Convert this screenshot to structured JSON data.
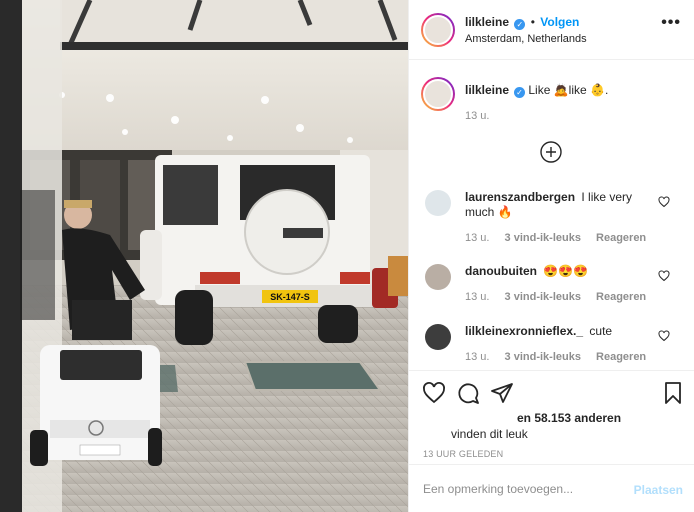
{
  "post": {
    "username": "lilkleine",
    "follow_label": "Volgen",
    "location": "Amsterdam, Netherlands",
    "more_label": "•••",
    "license_plate": "SK-147-S"
  },
  "caption": {
    "username": "lilkleine",
    "text": "Like 🙇like 👶.",
    "time": "13 u."
  },
  "load_more_icon": "plus-circle-icon",
  "comments": [
    {
      "username": "laurenszandbergen",
      "text": "I like very much 🔥",
      "time": "13 u.",
      "likes": "3 vind-ik-leuks",
      "reply": "Reageren"
    },
    {
      "username": "danoubuiten",
      "text": "😍😍😍",
      "time": "13 u.",
      "likes": "3 vind-ik-leuks",
      "reply": "Reageren"
    },
    {
      "username": "lilkleinexronnieflex._",
      "text": "cute",
      "time": "13 u.",
      "likes": "3 vind-ik-leuks",
      "reply": "Reageren"
    }
  ],
  "likes": {
    "line1": "en 58.153 anderen",
    "line2": "vinden dit leuk"
  },
  "time_ago": "13 UUR GELEDEN",
  "comment_input": {
    "placeholder": "Een opmerking toevoegen...",
    "post_label": "Plaatsen"
  },
  "colors": {
    "accent": "#0095f6",
    "verified": "#3897f0",
    "muted": "#8e8e8e",
    "post_disabled": "#b2dffc"
  }
}
